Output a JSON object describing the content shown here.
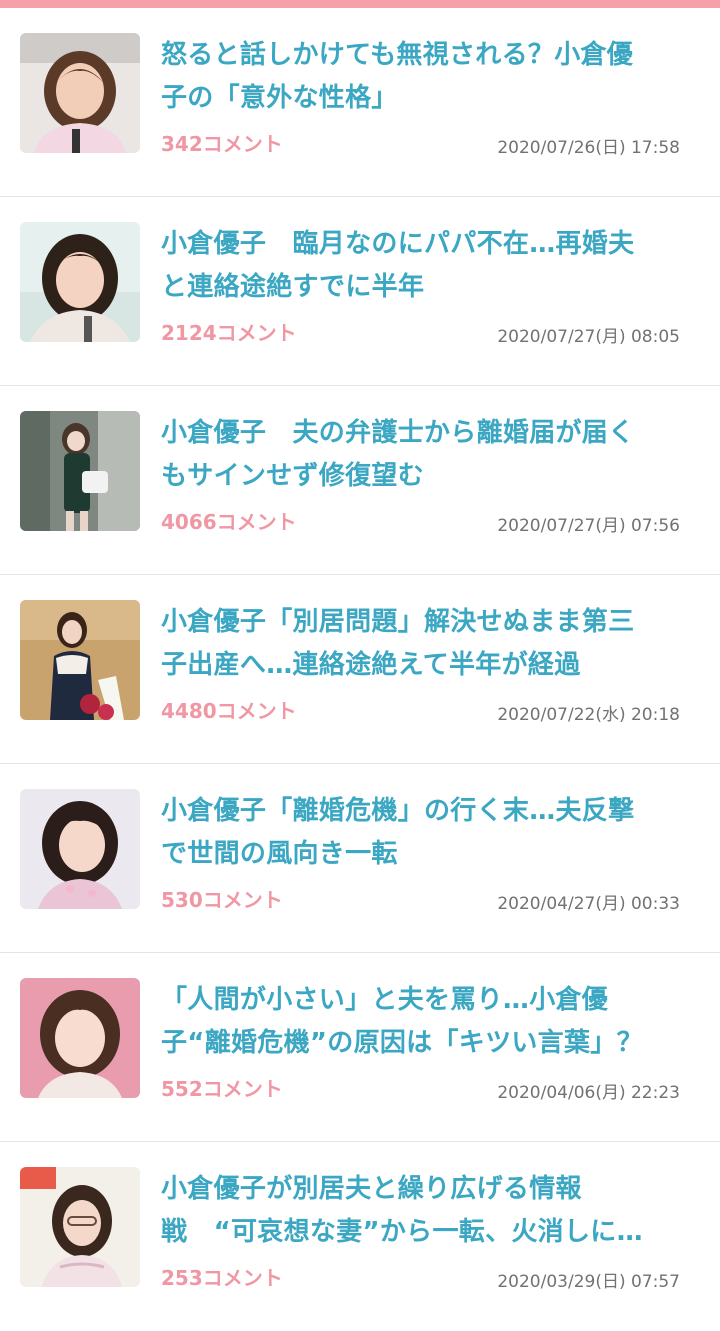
{
  "colors": {
    "accent_bar": "#f5a0ab",
    "title": "#3ba7c3",
    "comments": "#f097a4",
    "date": "#727272"
  },
  "articles": [
    {
      "title": "怒ると話しかけても無視される？小倉優\n子の「意外な性格」",
      "comments": "342コメント",
      "date": "2020/07/26(日) 17:58",
      "thumb_icon": "portrait-photo"
    },
    {
      "title": "小倉優子　臨月なのにパパ不在…再婚夫\nと連絡途絶すでに半年",
      "comments": "2124コメント",
      "date": "2020/07/27(月) 08:05",
      "thumb_icon": "portrait-photo"
    },
    {
      "title": "小倉優子　夫の弁護士から離婚届が届く\nもサインせず修復望む",
      "comments": "4066コメント",
      "date": "2020/07/27(月) 07:56",
      "thumb_icon": "portrait-photo"
    },
    {
      "title": "小倉優子「別居問題」解決せぬまま第三\n子出産へ…連絡途絶えて半年が経過",
      "comments": "4480コメント",
      "date": "2020/07/22(水) 20:18",
      "thumb_icon": "portrait-photo"
    },
    {
      "title": "小倉優子「離婚危機」の行く末…夫反撃\nで世間の風向き一転",
      "comments": "530コメント",
      "date": "2020/04/27(月) 00:33",
      "thumb_icon": "portrait-photo"
    },
    {
      "title": "「人間が小さい」と夫を罵り…小倉優\n子“離婚危機”の原因は「キツい言葉」？",
      "comments": "552コメント",
      "date": "2020/04/06(月) 22:23",
      "thumb_icon": "portrait-photo"
    },
    {
      "title": "小倉優子が別居夫と繰り広げる情報\n戦　“可哀想な妻”から一転、火消しに…",
      "comments": "253コメント",
      "date": "2020/03/29(日) 07:57",
      "thumb_icon": "portrait-photo"
    }
  ]
}
